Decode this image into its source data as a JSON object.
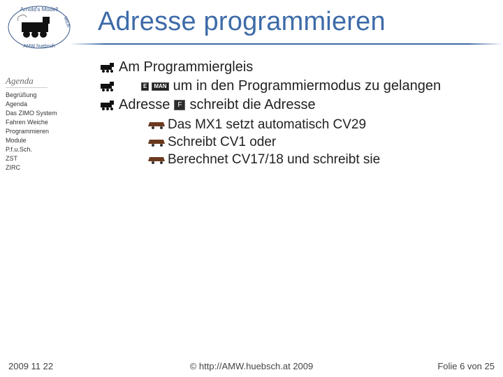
{
  "header": {
    "title": "Adresse programmieren"
  },
  "agenda_heading": "Agenda",
  "sidebar": {
    "items": [
      "Begrüßung",
      "Agenda",
      "Das ZIMO System",
      "Fahren Weiche",
      "Programmieren",
      "Module",
      "P.f.u.Sch.",
      "ZST",
      "ZIRC"
    ]
  },
  "content": {
    "main": [
      {
        "text": "Am Programmiergleis"
      },
      {
        "pre": "",
        "badge1": "E",
        "badge2": "MAN",
        "post": "um in den Programmiermodus zu gelangen"
      },
      {
        "pre": "Adresse",
        "badgeF": "F",
        "post": "schreibt die Adresse"
      }
    ],
    "sub": [
      "Das MX1 setzt automatisch CV29",
      "Schreibt CV1 oder",
      "Berechnet CV17/18 und schreibt sie"
    ]
  },
  "footer": {
    "left": "2009 11 22",
    "center": "© http://AMW.huebsch.at 2009",
    "right_pre": "Folie ",
    "right_num": "6",
    "right_mid": " von ",
    "right_total": "25"
  }
}
